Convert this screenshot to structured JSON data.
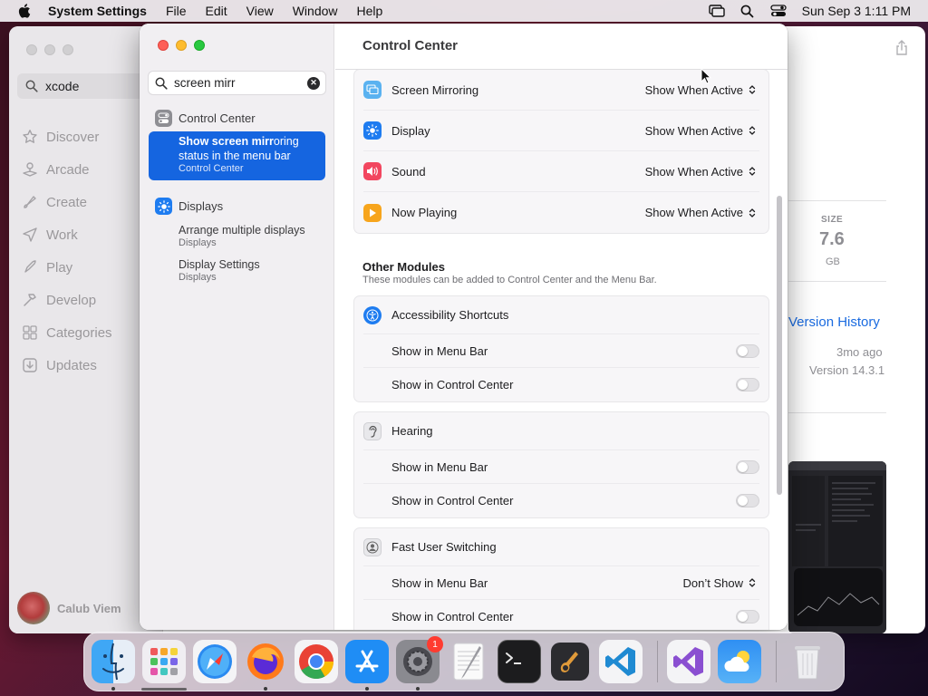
{
  "menubar": {
    "app_name": "System Settings",
    "items": [
      "File",
      "Edit",
      "View",
      "Window",
      "Help"
    ],
    "clock": "Sun Sep 3  1:11 PM"
  },
  "appstore": {
    "search_value": "xcode",
    "nav": [
      "Discover",
      "Arcade",
      "Create",
      "Work",
      "Play",
      "Develop",
      "Categories",
      "Updates"
    ],
    "user_name": "Calub Viem",
    "size_label": "SIZE",
    "size_value": "7.6",
    "size_unit": "GB",
    "version_history": "Version History",
    "ago": "3mo ago",
    "version": "Version 14.3.1"
  },
  "settings": {
    "search_value": "screen mirr",
    "results": {
      "group1": "Control Center",
      "selected_line1_bold": "Show screen mirr",
      "selected_line1_rest": "oring",
      "selected_line2": "status in the menu bar",
      "selected_sub": "Control Center",
      "group2": "Displays",
      "item1_title": "Arrange multiple displays",
      "item1_sub": "Displays",
      "item2_title": "Display Settings",
      "item2_sub": "Displays"
    },
    "title": "Control Center",
    "modules": [
      {
        "label": "Screen Mirroring",
        "value": "Show When Active"
      },
      {
        "label": "Display",
        "value": "Show When Active"
      },
      {
        "label": "Sound",
        "value": "Show When Active"
      },
      {
        "label": "Now Playing",
        "value": "Show When Active"
      }
    ],
    "other_title": "Other Modules",
    "other_sub": "These modules can be added to Control Center and the Menu Bar.",
    "accessibility": {
      "label": "Accessibility Shortcuts",
      "menu_bar": "Show in Menu Bar",
      "control_center": "Show in Control Center"
    },
    "hearing": {
      "label": "Hearing",
      "menu_bar": "Show in Menu Bar",
      "control_center": "Show in Control Center"
    },
    "fus": {
      "label": "Fast User Switching",
      "menu_bar": "Show in Menu Bar",
      "menu_bar_value": "Don’t Show",
      "control_center": "Show in Control Center"
    }
  },
  "dock": {
    "badge_count": "1"
  },
  "colors": {
    "accent": "#1565e0",
    "link": "#1a6be0",
    "close": "#fe5f57",
    "minimize": "#febc2e",
    "maximize": "#28c840"
  }
}
